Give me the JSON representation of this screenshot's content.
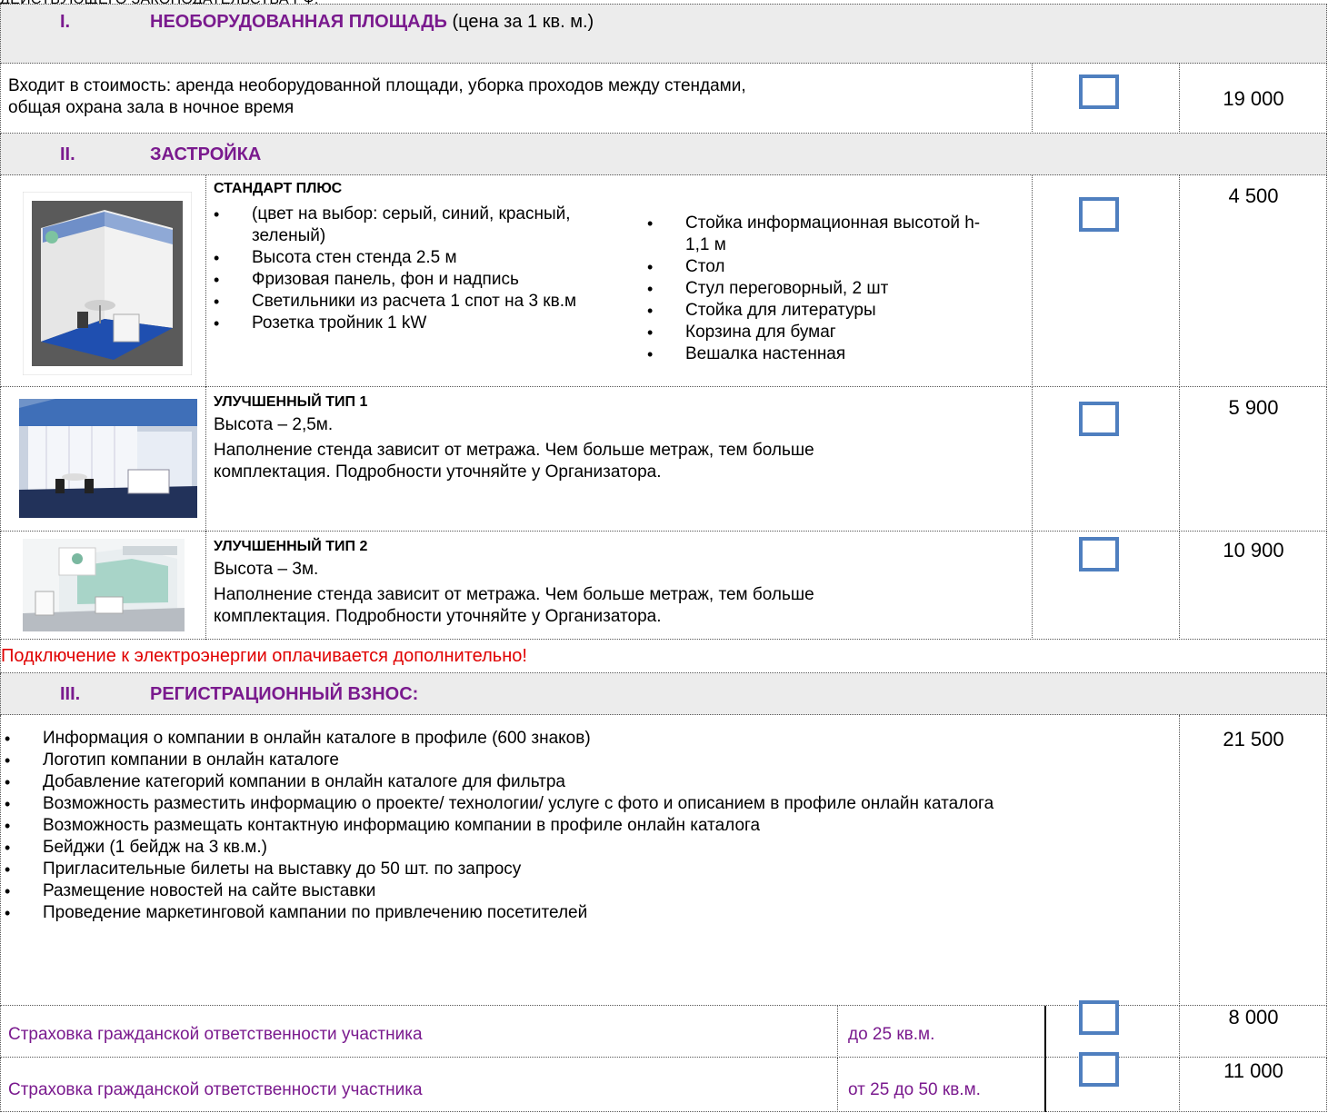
{
  "cut_heading": "ДЕЙСТВУЮЩЕГО ЗАКОНОДАТЕЛЬСТВА РФ.",
  "section1": {
    "num": "I.",
    "title": "НЕОБОРУДОВАННАЯ ПЛОЩАДЬ",
    "suffix": " (цена за 1 кв. м.)",
    "item": {
      "text_line1": "Входит в стоимость: аренда необорудованной площади, уборка проходов между стендами,",
      "text_line2": "общая охрана зала в ночное время",
      "price": "19 000"
    }
  },
  "section2": {
    "num": "II.",
    "title": "ЗАСТРОЙКА",
    "standard_plus": {
      "title": "СТАНДАРТ ПЛЮС",
      "left_items": [
        "(цвет на выбор: серый, синий, красный, зеленый)",
        "Высота стен стенда 2.5 м",
        "Фризовая панель, фон и надпись",
        "Светильники из расчета 1 спот на 3 кв.м",
        "Розетка тройник 1 kW"
      ],
      "right_items": [
        "Стойка информационная высотой h-1,1 м",
        "Стол",
        "Стул переговорный, 2 шт",
        "Стойка для литературы",
        "Корзина для бумаг",
        "Вешалка настенная"
      ],
      "price": "4 500"
    },
    "improved1": {
      "title": "УЛУЧШЕННЫЙ ТИП 1",
      "height": "Высота – 2,5м.",
      "desc_line1": "Наполнение стенда зависит от метража. Чем больше метраж, тем больше",
      "desc_line2": "комплектация. Подробности уточняйте у Организатора.",
      "price": "5 900"
    },
    "improved2": {
      "title": "УЛУЧШЕННЫЙ ТИП 2",
      "height": "Высота – 3м.",
      "desc_line1": "Наполнение стенда зависит от метража. Чем больше метраж, тем больше",
      "desc_line2": "комплектация. Подробности уточняйте у Организатора.",
      "price": "10 900"
    },
    "power_note": "Подключение к электроэнергии оплачивается дополнительно!"
  },
  "section3": {
    "num": "III.",
    "title": "РЕГИСТРАЦИОННЫЙ ВЗНОС:",
    "items": [
      "Информация о компании в онлайн каталоге в профиле (600 знаков)",
      "Логотип компании в онлайн каталоге",
      "Добавление категорий компании в онлайн каталоге для фильтра",
      "Возможность разместить информацию о проекте/ технологии/ услуге с фото и описанием в профиле онлайн каталога",
      "Возможность размещать контактную информацию компании в профиле онлайн каталога",
      "Бейджи  (1 бейдж на 3 кв.м.)",
      "Пригласительные билеты на выставку до 50 шт. по запросу",
      "Размещение новостей на сайте выставки",
      "Проведение маркетинговой кампании по привлечению посетителей"
    ],
    "price": "21 500"
  },
  "insurance": [
    {
      "label": "Страховка гражданской ответственности участника",
      "range": "до 25 кв.м.",
      "price": "8 000"
    },
    {
      "label": "Страховка гражданской ответственности участника",
      "range": "от 25 до 50 кв.м.",
      "price": "11 000"
    }
  ],
  "colors": {
    "section_title": "#7a1a8e",
    "checkbox": "#4f7fbf",
    "warning": "#e00000",
    "header_bg": "#ececec"
  }
}
